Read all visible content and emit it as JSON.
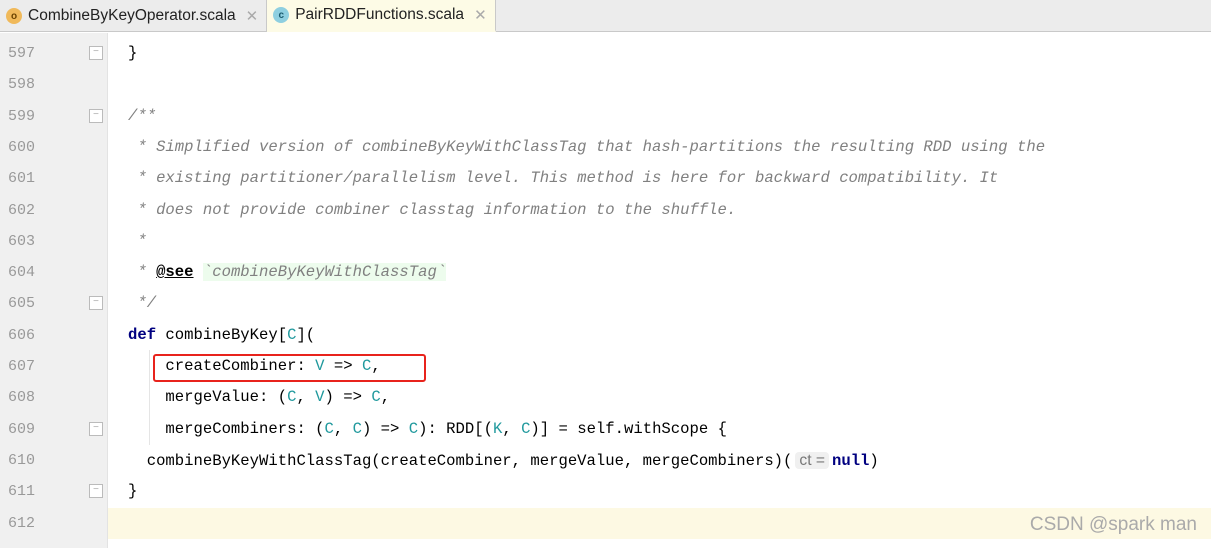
{
  "tabs": [
    {
      "label": "CombineByKeyOperator.scala",
      "icon": "scala-object-icon",
      "active": false
    },
    {
      "label": "PairRDDFunctions.scala",
      "icon": "scala-class-icon",
      "active": true
    }
  ],
  "lines": [
    {
      "n": "597",
      "fold": "end",
      "indent": 0,
      "tokens": [
        {
          "t": "pl",
          "s": "}"
        }
      ]
    },
    {
      "n": "598",
      "indent": 0,
      "tokens": []
    },
    {
      "n": "599",
      "fold": "start",
      "indent": 0,
      "tokens": [
        {
          "t": "cm",
          "s": "/**"
        }
      ]
    },
    {
      "n": "600",
      "indent": 0,
      "tokens": [
        {
          "t": "cm",
          "s": " * Simplified version of combineByKeyWithClassTag that hash-partitions the resulting RDD using the"
        }
      ]
    },
    {
      "n": "601",
      "indent": 0,
      "tokens": [
        {
          "t": "cm",
          "s": " * existing partitioner/parallelism level. This method is here for backward compatibility. It"
        }
      ]
    },
    {
      "n": "602",
      "indent": 0,
      "tokens": [
        {
          "t": "cm",
          "s": " * does not provide combiner classtag information to the shuffle."
        }
      ]
    },
    {
      "n": "603",
      "indent": 0,
      "tokens": [
        {
          "t": "cm",
          "s": " *"
        }
      ]
    },
    {
      "n": "604",
      "indent": 0,
      "tokens": [
        {
          "t": "cm",
          "s": " * "
        },
        {
          "t": "tag",
          "s": "@see"
        },
        {
          "t": "cm",
          "s": " "
        },
        {
          "t": "ref",
          "s": "`combineByKeyWithClassTag`"
        }
      ]
    },
    {
      "n": "605",
      "fold": "end",
      "indent": 0,
      "tokens": [
        {
          "t": "cm",
          "s": " */"
        }
      ]
    },
    {
      "n": "606",
      "indent": 0,
      "tokens": [
        {
          "t": "kw",
          "s": "def"
        },
        {
          "t": "pl",
          "s": " combineByKey["
        },
        {
          "t": "ty",
          "s": "C"
        },
        {
          "t": "pl",
          "s": "]("
        }
      ]
    },
    {
      "n": "607",
      "indent": 0,
      "tokens": [
        {
          "t": "pl",
          "s": "    createCombiner: "
        },
        {
          "t": "ty",
          "s": "V"
        },
        {
          "t": "pl",
          "s": " => "
        },
        {
          "t": "ty",
          "s": "C"
        },
        {
          "t": "pl",
          "s": ","
        }
      ]
    },
    {
      "n": "608",
      "indent": 0,
      "tokens": [
        {
          "t": "pl",
          "s": "    mergeValue: ("
        },
        {
          "t": "ty",
          "s": "C"
        },
        {
          "t": "pl",
          "s": ", "
        },
        {
          "t": "ty",
          "s": "V"
        },
        {
          "t": "pl",
          "s": ") => "
        },
        {
          "t": "ty",
          "s": "C"
        },
        {
          "t": "pl",
          "s": ","
        }
      ]
    },
    {
      "n": "609",
      "fold": "start",
      "indent": 0,
      "tokens": [
        {
          "t": "pl",
          "s": "    mergeCombiners: ("
        },
        {
          "t": "ty",
          "s": "C"
        },
        {
          "t": "pl",
          "s": ", "
        },
        {
          "t": "ty",
          "s": "C"
        },
        {
          "t": "pl",
          "s": ") => "
        },
        {
          "t": "ty",
          "s": "C"
        },
        {
          "t": "pl",
          "s": "): RDD[("
        },
        {
          "t": "ty",
          "s": "K"
        },
        {
          "t": "pl",
          "s": ", "
        },
        {
          "t": "ty",
          "s": "C"
        },
        {
          "t": "pl",
          "s": ")] = self.withScope {"
        }
      ]
    },
    {
      "n": "610",
      "indent": 0,
      "tokens": [
        {
          "t": "pl",
          "s": "  combineByKeyWithClassTag(createCombiner, mergeValue, mergeCombiners)("
        },
        {
          "t": "hint",
          "s": "ct ="
        },
        {
          "t": "kw",
          "s": "null"
        },
        {
          "t": "pl",
          "s": ")"
        }
      ]
    },
    {
      "n": "611",
      "fold": "end",
      "indent": 0,
      "tokens": [
        {
          "t": "pl",
          "s": "}"
        }
      ]
    },
    {
      "n": "612",
      "current": true,
      "indent": 0,
      "tokens": []
    }
  ],
  "watermark": "CSDN @spark man",
  "colors": {
    "keyword": "#000080",
    "type_param": "#20999d",
    "comment": "#808080",
    "highlight_box": "#e8231c",
    "current_line": "#fdf9e3"
  }
}
